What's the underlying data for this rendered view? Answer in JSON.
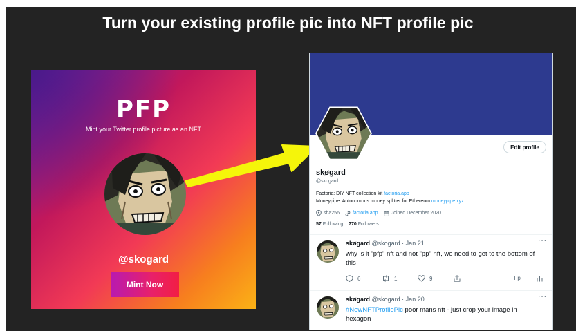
{
  "headline": "Turn your existing profile pic into NFT profile pic",
  "card": {
    "title": "PFP",
    "subtitle": "Mint your Twitter profile picture as an NFT",
    "handle": "@skogard",
    "mint_label": "Mint Now"
  },
  "profile": {
    "edit_label": "Edit profile",
    "name": "skøgard",
    "handle": "@skogard",
    "bio_line1_prefix": "Factoria: DIY NFT collection kit ",
    "bio_line1_link": "factoria.app",
    "bio_line2_prefix": "Moneypipe: Autonomous money splitter for Ethereum ",
    "bio_line2_link": "moneypipe.xyz",
    "location": "sha256",
    "website": "factoria.app",
    "joined": "Joined December 2020",
    "following_count": "57",
    "following_label": "Following",
    "followers_count": "770",
    "followers_label": "Followers"
  },
  "tweets": [
    {
      "name": "skøgard",
      "meta": "@skogard · Jan 21",
      "text": "why is it \"pfp\" nft and not \"pp\" nft, we need to get to the bottom of this",
      "replies": "6",
      "retweets": "1",
      "likes": "9",
      "tip_label": "Tip"
    },
    {
      "name": "skøgard",
      "meta": "@skogard · Jan 20",
      "hashtag": "#NewNFTProfilePic",
      "text": " poor mans nft - just crop your image in hexagon"
    }
  ],
  "colors": {
    "background": "#232323",
    "banner": "#2d3a8f",
    "link": "#1d9bf0",
    "arrow": "#f5f50a"
  }
}
